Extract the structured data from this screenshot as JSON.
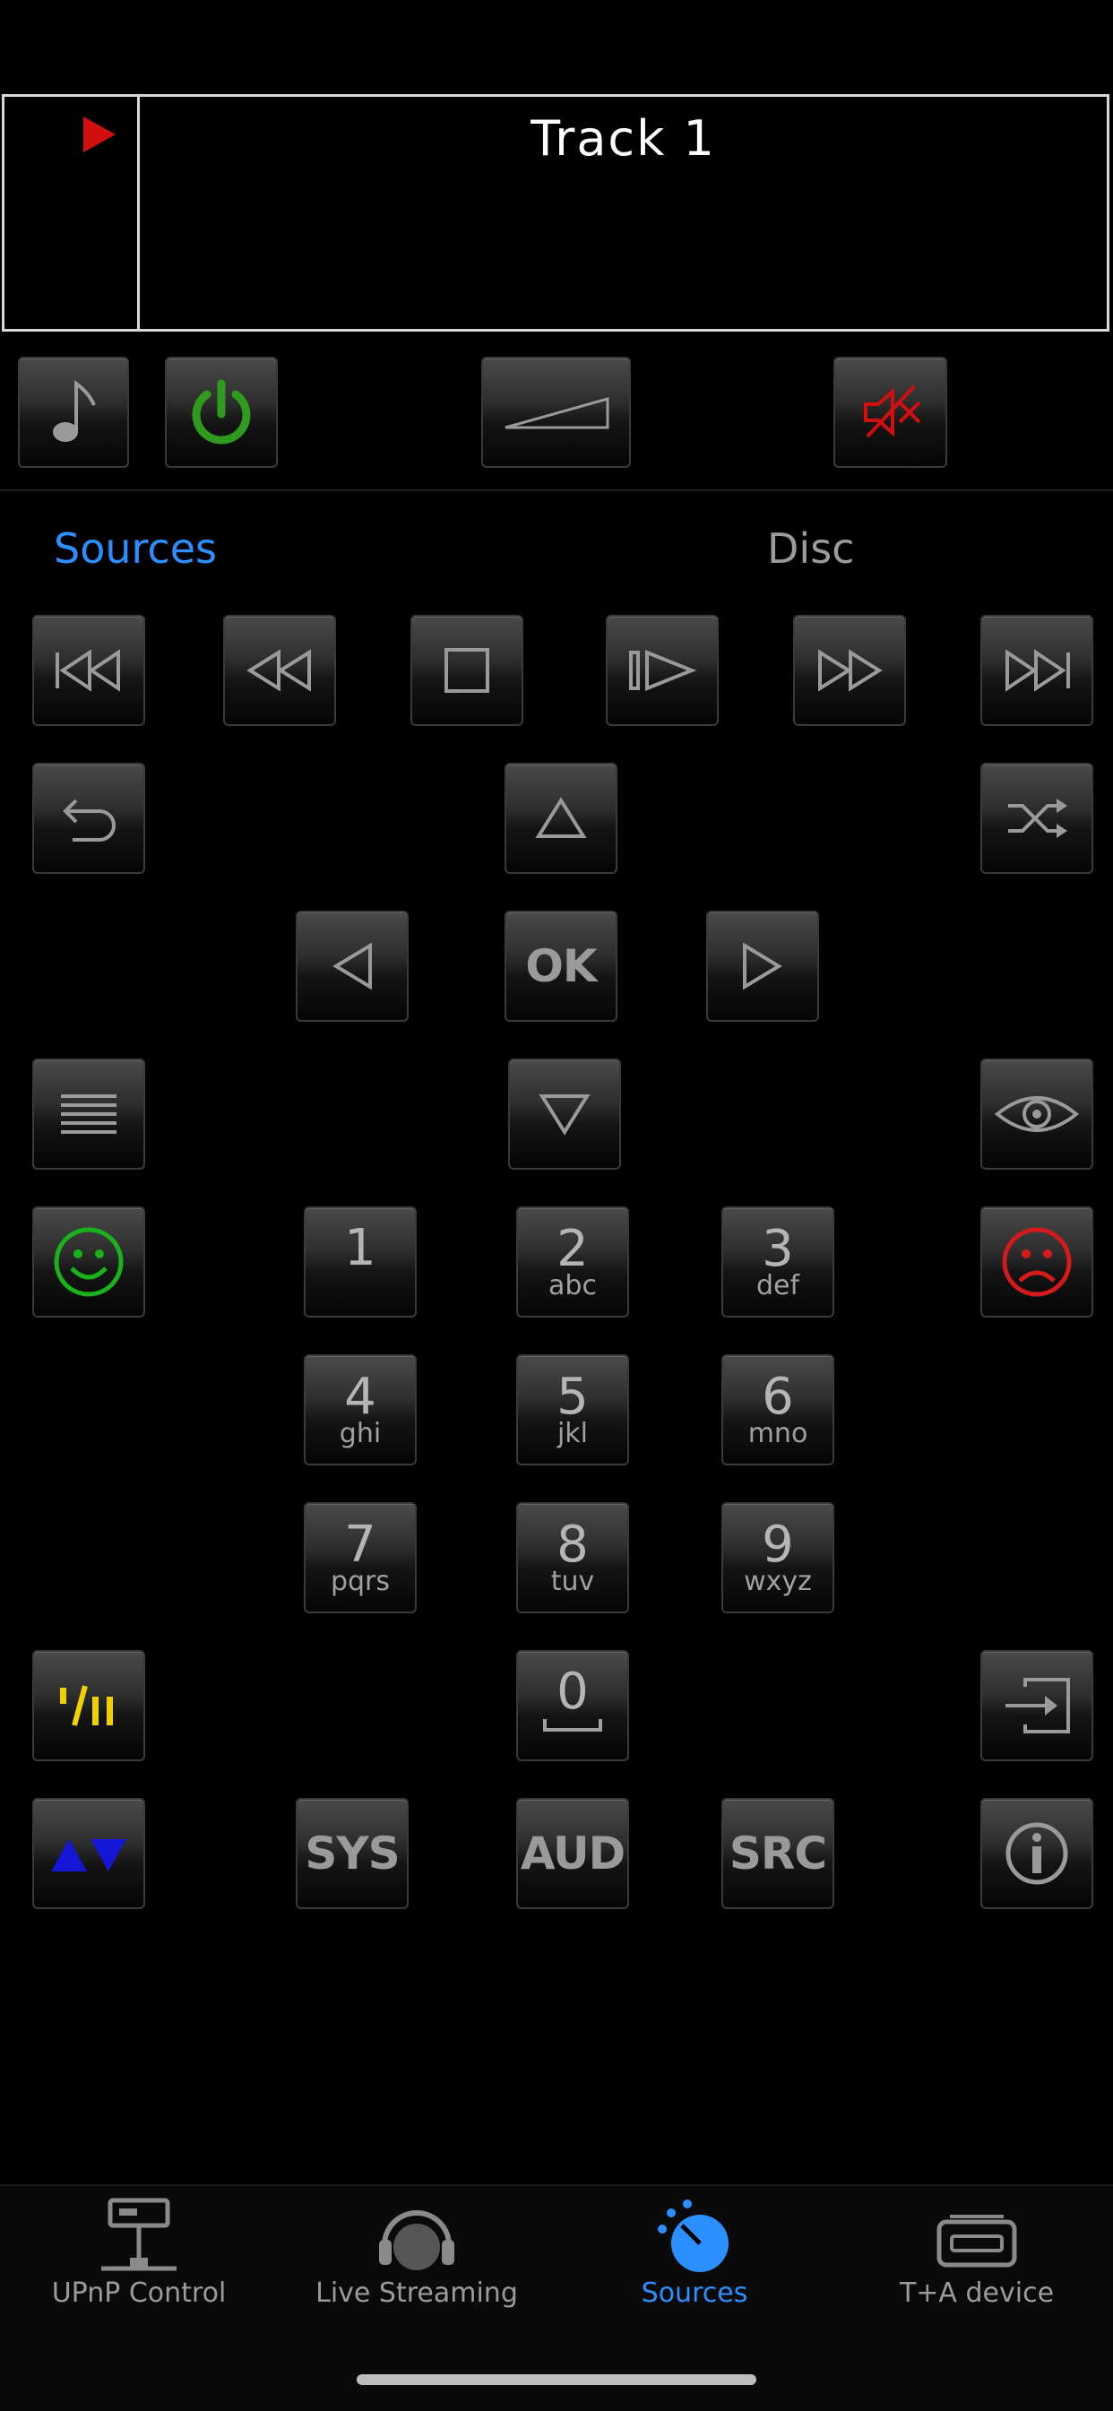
{
  "display": {
    "track": "Track  1"
  },
  "tabs": {
    "sources": "Sources",
    "disc": "Disc"
  },
  "keypad": {
    "d1": {
      "main": "1",
      "sub": ""
    },
    "d2": {
      "main": "2",
      "sub": "abc"
    },
    "d3": {
      "main": "3",
      "sub": "def"
    },
    "d4": {
      "main": "4",
      "sub": "ghi"
    },
    "d5": {
      "main": "5",
      "sub": "jkl"
    },
    "d6": {
      "main": "6",
      "sub": "mno"
    },
    "d7": {
      "main": "7",
      "sub": "pqrs"
    },
    "d8": {
      "main": "8",
      "sub": "tuv"
    },
    "d9": {
      "main": "9",
      "sub": "wxyz"
    },
    "d0": {
      "main": "0",
      "sub": ""
    }
  },
  "buttons": {
    "ok": "OK",
    "sys": "SYS",
    "aud": "AUD",
    "src": "SRC"
  },
  "tabbar": {
    "upnp": "UPnP Control",
    "live": "Live Streaming",
    "sources": "Sources",
    "device": "T+A device"
  },
  "colors": {
    "accent": "#2b8fff",
    "power": "#2f9a1e",
    "mute": "#d10f0f",
    "happy": "#1ab21a",
    "sad": "#d41a1a",
    "yellow": "#f0d000",
    "blue": "#1515d6"
  }
}
